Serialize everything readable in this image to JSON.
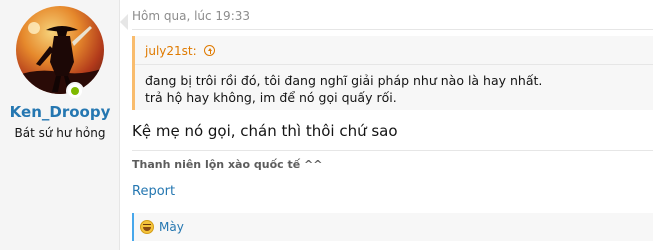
{
  "author": {
    "username": "Ken_Droopy",
    "user_title": "Bát sứ hư hỏng",
    "online": true
  },
  "post": {
    "timestamp": "Hôm qua, lúc 19:33",
    "quote": {
      "author": "july21st:",
      "line1": "đang bị trôi rồi đó, tôi đang nghĩ giải pháp như nào là hay nhất.",
      "line2": "trả hộ hay không, im để nó gọi quấy rối."
    },
    "message": "Kệ mẹ nó gọi, chán thì thôi chứ sao",
    "signature": "Thanh niên lộn xào quốc tế ^^",
    "report_label": "Report",
    "reaction": {
      "icon": "laugh-emoji-icon",
      "users": "Mày"
    }
  },
  "colors": {
    "link": "#2577b1",
    "quote_accent": "#df7a00",
    "online": "#7fb900"
  }
}
